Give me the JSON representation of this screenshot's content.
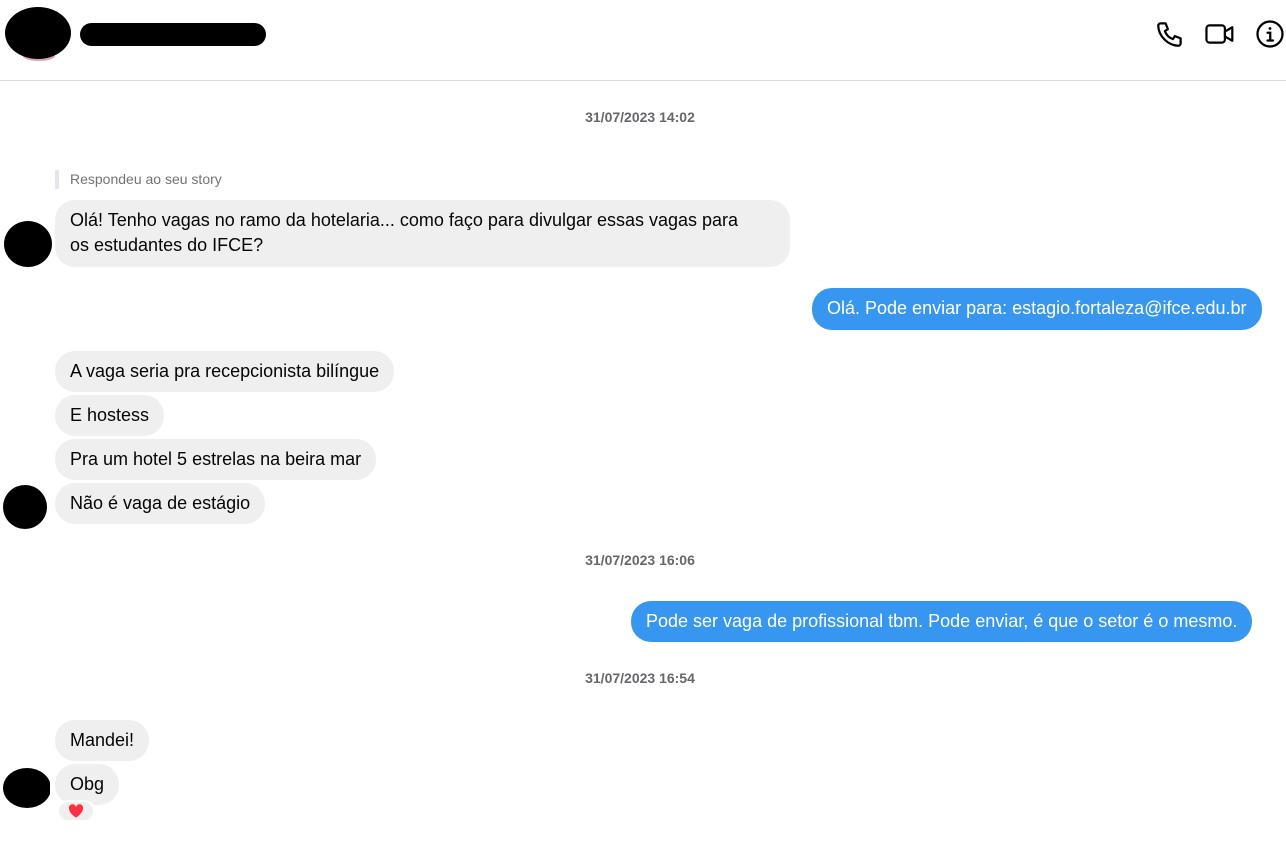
{
  "reply_label": "Respondeu ao seu story",
  "timestamps": [
    "31/07/2023 14:02",
    "31/07/2023 16:06",
    "31/07/2023 16:54"
  ],
  "messages": [
    {
      "line1": "Olá! Tenho vagas no ramo da hotelaria... como faço para divulgar essas vagas para",
      "line2": "os estudantes do IFCE?"
    },
    {
      "text": "Olá. Pode enviar para: estagio.fortaleza@ifce.edu.br"
    },
    {
      "text": "A vaga seria pra recepcionista bilíngue"
    },
    {
      "text": "E hostess"
    },
    {
      "text": "Pra um hotel 5 estrelas na beira mar"
    },
    {
      "text": "Não é vaga de estágio"
    },
    {
      "text": "Pode ser vaga de profissional tbm. Pode enviar, é que o setor é o mesmo."
    },
    {
      "text": "Mandei!"
    },
    {
      "text": "Obg"
    }
  ],
  "icons": {
    "call": "phone-icon",
    "video": "video-camera-icon",
    "info": "info-icon",
    "reaction": "heart-icon"
  },
  "colors": {
    "outgoing_bubble": "#3797f0",
    "incoming_bubble": "#efefef",
    "reaction_heart": "#ff3040"
  }
}
